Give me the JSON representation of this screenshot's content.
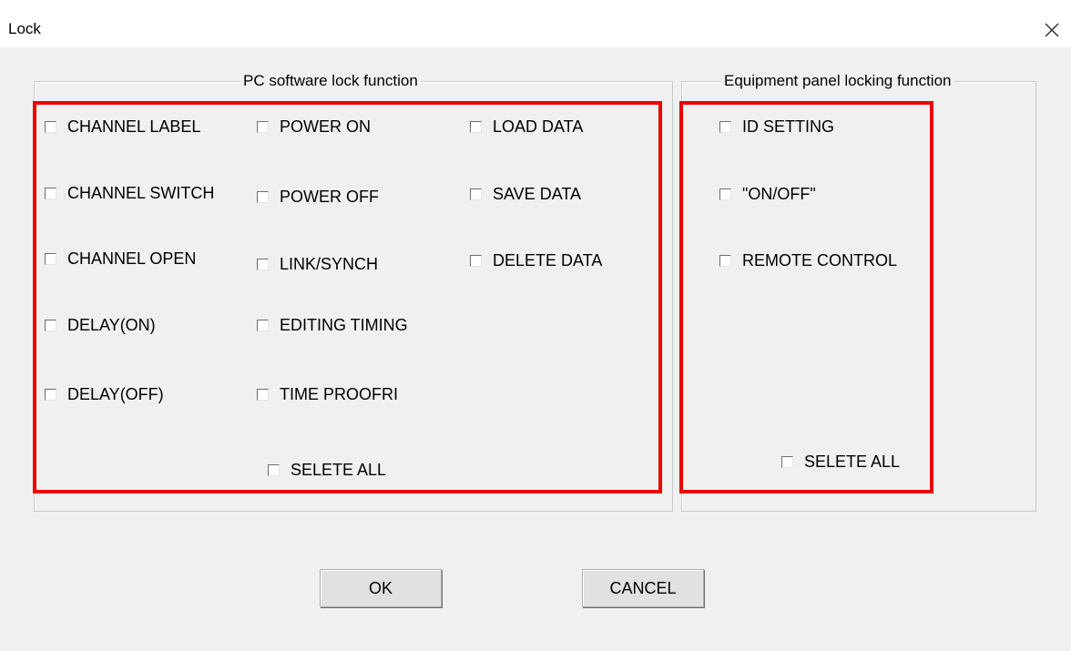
{
  "window": {
    "title": "Lock",
    "close_icon": "close-icon"
  },
  "pc_group": {
    "legend": "PC software lock function",
    "items": [
      {
        "label": "CHANNEL LABEL",
        "checked": false
      },
      {
        "label": "CHANNEL SWITCH",
        "checked": false
      },
      {
        "label": "CHANNEL OPEN",
        "checked": false
      },
      {
        "label": "DELAY(ON)",
        "checked": false
      },
      {
        "label": "DELAY(OFF)",
        "checked": false
      },
      {
        "label": "POWER ON",
        "checked": false
      },
      {
        "label": "POWER OFF",
        "checked": false
      },
      {
        "label": "LINK/SYNCH",
        "checked": false
      },
      {
        "label": "EDITING TIMING",
        "checked": false
      },
      {
        "label": "TIME PROOFRI",
        "checked": false
      },
      {
        "label": "LOAD DATA",
        "checked": false
      },
      {
        "label": "SAVE DATA",
        "checked": false
      },
      {
        "label": "DELETE DATA",
        "checked": false
      }
    ],
    "select_all": {
      "label": "SELETE ALL",
      "checked": false
    }
  },
  "equip_group": {
    "legend": "Equipment panel locking function",
    "items": [
      {
        "label": "ID SETTING",
        "checked": false
      },
      {
        "label": "\"ON/OFF\"",
        "checked": false
      },
      {
        "label": "REMOTE CONTROL",
        "checked": false
      }
    ],
    "select_all": {
      "label": "SELETE ALL",
      "checked": false
    }
  },
  "buttons": {
    "ok": "OK",
    "cancel": "CANCEL"
  },
  "colors": {
    "highlight": "#ee0000",
    "background": "#f0f0f0"
  }
}
